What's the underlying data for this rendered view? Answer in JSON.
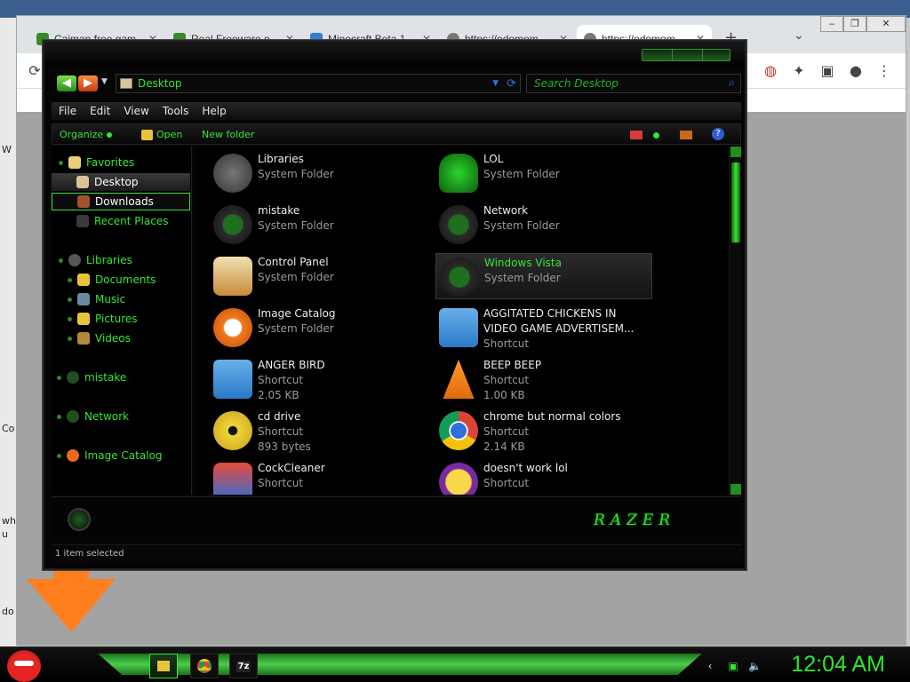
{
  "browser": {
    "tabs": [
      {
        "label": "Caiman free gam",
        "color": "#3a8a2a"
      },
      {
        "label": "Real Freeware o",
        "color": "#3a8a2a"
      },
      {
        "label": "Minecraft Beta 1",
        "color": "#2f7fd8"
      },
      {
        "label": "https://odomom",
        "color": "#777777"
      },
      {
        "label": "https://odomom",
        "color": "#777777"
      }
    ],
    "new_tab": "+",
    "tab_close": "✕",
    "tab_list": "⌄"
  },
  "desktop": {
    "edge_labels": [
      "W",
      "Co",
      "wh",
      "u",
      "do"
    ]
  },
  "explorer": {
    "address": "Desktop",
    "search_placeholder": "Search Desktop",
    "menu": [
      "File",
      "Edit",
      "View",
      "Tools",
      "Help"
    ],
    "commands": {
      "organize": "Organize",
      "open": "Open",
      "new_folder": "New folder"
    },
    "sidebar": {
      "favorites": "Favorites",
      "desktop": "Desktop",
      "downloads": "Downloads",
      "recent_places": "Recent Places",
      "libraries": "Libraries",
      "documents": "Documents",
      "music": "Music",
      "pictures": "Pictures",
      "videos": "Videos",
      "mistake": "mistake",
      "network": "Network",
      "image_catalog": "Image Catalog"
    },
    "items": [
      {
        "name": "Libraries",
        "type": "System Folder",
        "size": "",
        "icon": "libraries-icon",
        "col": 0,
        "row": 0
      },
      {
        "name": "LOL",
        "type": "System Folder",
        "size": "",
        "icon": "lol-user-icon",
        "col": 1,
        "row": 0
      },
      {
        "name": "mistake",
        "type": "System Folder",
        "size": "",
        "icon": "mistake-icon",
        "col": 0,
        "row": 1
      },
      {
        "name": "Network",
        "type": "System Folder",
        "size": "",
        "icon": "network-icon",
        "col": 1,
        "row": 1
      },
      {
        "name": "Control Panel",
        "type": "System Folder",
        "size": "",
        "icon": "control-panel-icon",
        "col": 0,
        "row": 2
      },
      {
        "name": "Windows Vista",
        "type": "System Folder",
        "size": "",
        "icon": "recycle-bin-icon",
        "col": 1,
        "row": 2
      },
      {
        "name": "Image Catalog",
        "type": "System Folder",
        "size": "",
        "icon": "image-catalog-icon",
        "col": 0,
        "row": 3
      },
      {
        "name": "AGGITATED CHICKENS IN VIDEO GAME ADVERTISEM...",
        "type": "Shortcut",
        "size": "",
        "icon": "angry-birds-icon",
        "col": 1,
        "row": 3
      },
      {
        "name": "ANGER BIRD",
        "type": "Shortcut",
        "size": "2.05 KB",
        "icon": "angry-bird-icon",
        "col": 0,
        "row": 4
      },
      {
        "name": "BEEP BEEP",
        "type": "Shortcut",
        "size": "1.00 KB",
        "icon": "vlc-cone-icon",
        "col": 1,
        "row": 4
      },
      {
        "name": "cd drive",
        "type": "Shortcut",
        "size": "893 bytes",
        "icon": "cd-drive-icon",
        "col": 0,
        "row": 5
      },
      {
        "name": "chrome but normal colors",
        "type": "Shortcut",
        "size": "2.14 KB",
        "icon": "chrome-icon",
        "col": 1,
        "row": 5
      },
      {
        "name": "CockCleaner",
        "type": "Shortcut",
        "size": "",
        "icon": "ccleaner-icon",
        "col": 0,
        "row": 6
      },
      {
        "name": "doesn't work lol",
        "type": "Shortcut",
        "size": "",
        "icon": "yahoo-messenger-icon",
        "col": 1,
        "row": 6
      }
    ],
    "selected_item": "Windows Vista",
    "logo_text": "RAZER",
    "status": "1 item selected"
  },
  "taskbar": {
    "clock": "12:04 AM",
    "apps": [
      "explorer-icon",
      "chrome-icon",
      "7zip-icon"
    ],
    "seven_zip_label": "7z"
  },
  "colors": {
    "accent": "#35e635",
    "window_bg": "#050505",
    "arrow": "#ff7f1f"
  }
}
